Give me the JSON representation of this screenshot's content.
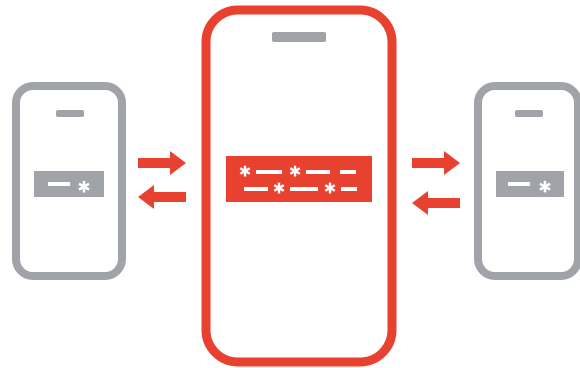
{
  "colors": {
    "accent": "#e8412f",
    "neutral": "#a0a3a8",
    "mark": "#ffffff",
    "background": "#ffffff"
  },
  "icons": {
    "main_device": "phone-icon",
    "side_devices": "phone-icon",
    "code_symbol": "asterisk-icon",
    "exchange": "bidirectional-arrow-icon"
  }
}
